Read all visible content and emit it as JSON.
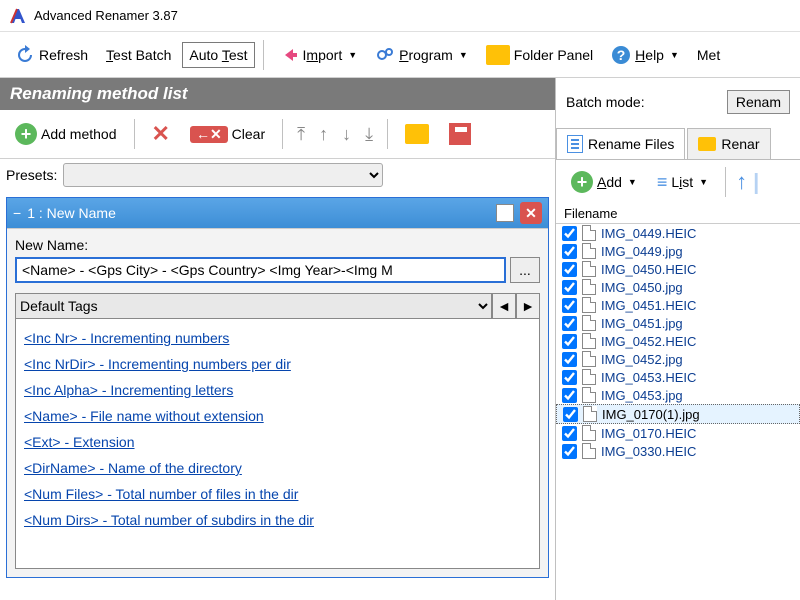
{
  "window": {
    "title": "Advanced Renamer 3.87"
  },
  "toolbar": {
    "refresh": "Refresh",
    "test_batch": "Test Batch",
    "auto_test": "Auto Test",
    "import": "Import",
    "program": "Program",
    "folder_panel": "Folder Panel",
    "help": "Help",
    "met": "Met"
  },
  "left_panel": {
    "header": "Renaming method list",
    "add_method": "Add method",
    "clear": "Clear",
    "presets_label": "Presets:",
    "method1": {
      "title": "1 : New Name",
      "checked": true,
      "new_name_label": "New Name:",
      "new_name_value": "<Name> - <Gps City> - <Gps Country> <Img Year>-<Img M",
      "default_tags_label": "Default Tags",
      "tags": [
        "<Inc Nr> - Incrementing numbers",
        "<Inc NrDir> - Incrementing numbers per dir",
        "<Inc Alpha> - Incrementing letters",
        "<Name> - File name without extension",
        "<Ext> - Extension",
        "<DirName> - Name of the directory",
        "<Num Files> - Total number of files in the dir",
        "<Num Dirs> - Total number of subdirs in the dir"
      ]
    }
  },
  "right_panel": {
    "batch_mode_label": "Batch mode:",
    "batch_mode_value": "Renam",
    "tab_rename": "Rename Files",
    "tab_folders": "Renar",
    "add": "Add",
    "list": "List",
    "col_filename": "Filename",
    "files": [
      {
        "name": "IMG_0449.HEIC",
        "checked": true,
        "selected": false
      },
      {
        "name": "IMG_0449.jpg",
        "checked": true,
        "selected": false
      },
      {
        "name": "IMG_0450.HEIC",
        "checked": true,
        "selected": false
      },
      {
        "name": "IMG_0450.jpg",
        "checked": true,
        "selected": false
      },
      {
        "name": "IMG_0451.HEIC",
        "checked": true,
        "selected": false
      },
      {
        "name": "IMG_0451.jpg",
        "checked": true,
        "selected": false
      },
      {
        "name": "IMG_0452.HEIC",
        "checked": true,
        "selected": false
      },
      {
        "name": "IMG_0452.jpg",
        "checked": true,
        "selected": false
      },
      {
        "name": "IMG_0453.HEIC",
        "checked": true,
        "selected": false
      },
      {
        "name": "IMG_0453.jpg",
        "checked": true,
        "selected": false
      },
      {
        "name": "IMG_0170(1).jpg",
        "checked": true,
        "selected": true
      },
      {
        "name": "IMG_0170.HEIC",
        "checked": true,
        "selected": false
      },
      {
        "name": "IMG_0330.HEIC",
        "checked": true,
        "selected": false
      }
    ]
  }
}
